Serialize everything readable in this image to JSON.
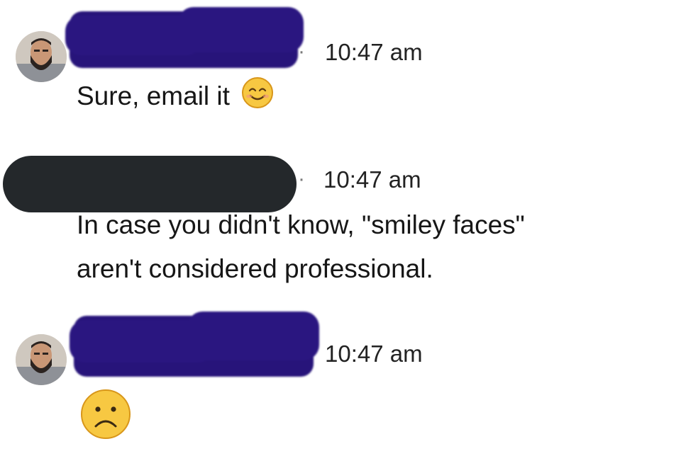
{
  "messages": [
    {
      "sender": "redacted",
      "time": "10:47 am",
      "separator": "·",
      "text": "Sure, email it",
      "emoji": "smiling-face-icon"
    },
    {
      "sender": "redacted",
      "time": "10:47 am",
      "separator": "·",
      "lines": [
        "In case you didn't know, \"smiley faces\"",
        "aren't considered professional."
      ]
    },
    {
      "sender": "redacted",
      "time": "10:47 am",
      "emoji": "frowning-face-icon"
    }
  ],
  "colors": {
    "scribble": "#27147a",
    "redaction_pill": "#24282b",
    "emoji_fill": "#f7c842",
    "emoji_outline": "#d8961a"
  }
}
